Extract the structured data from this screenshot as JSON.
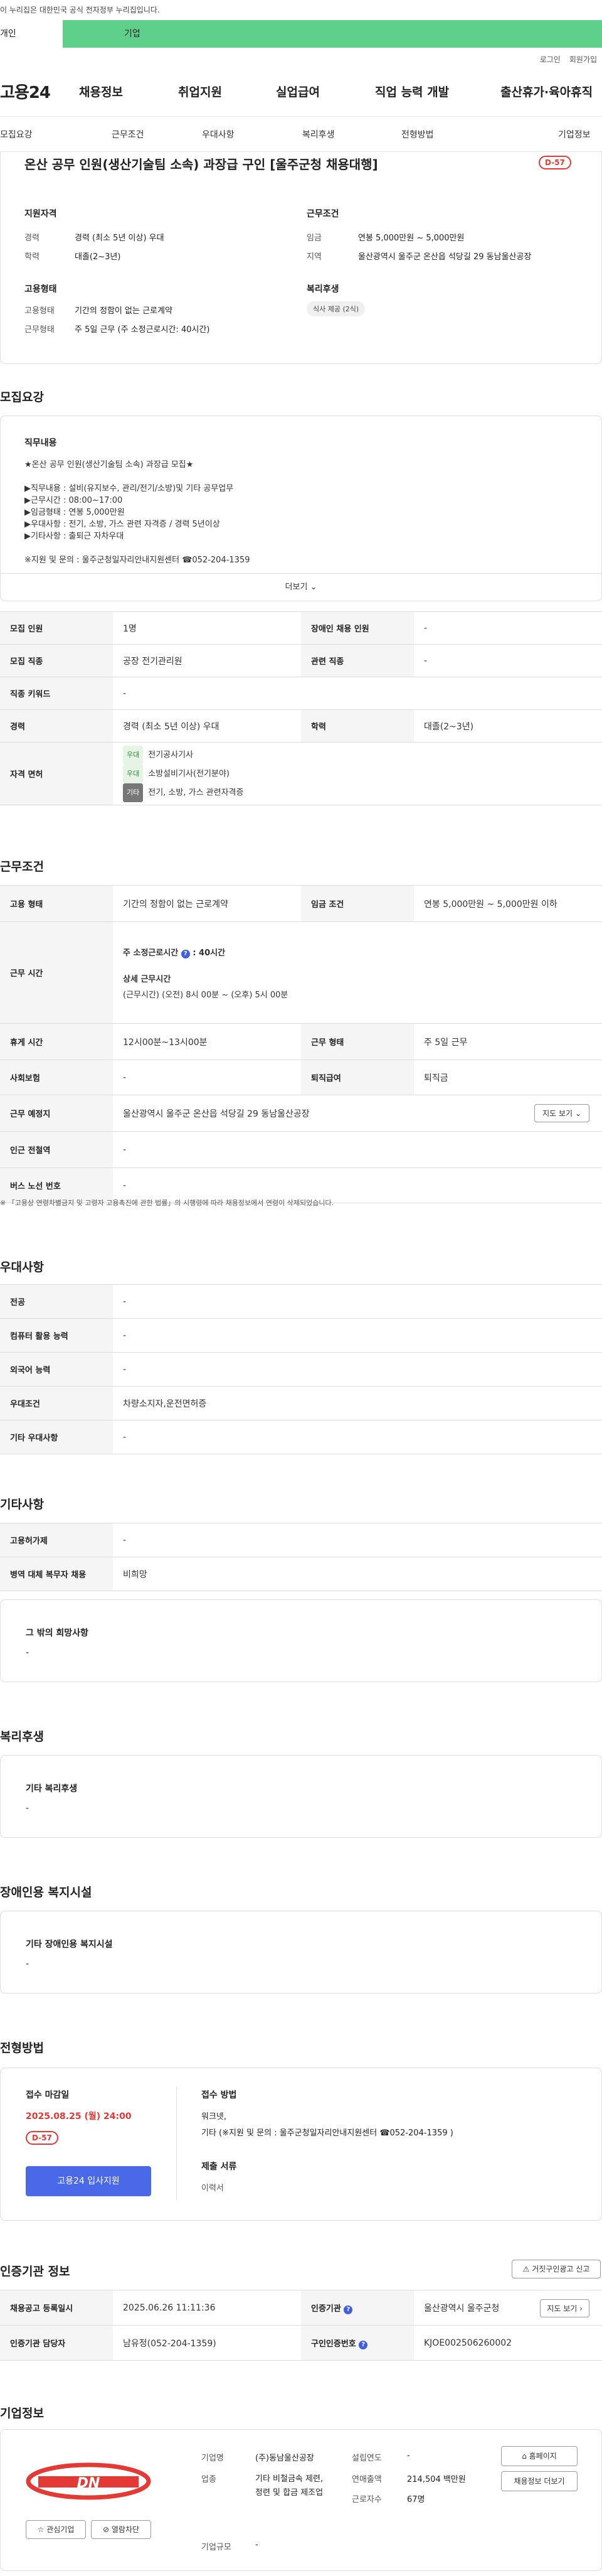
{
  "gov_notice": "이 누리집은 대한민국 공식 전자정부 누리집입니다.",
  "user_tabs": {
    "person": "개인",
    "company": "기업"
  },
  "top_links": {
    "login": "로그인",
    "signup": "회원가입"
  },
  "gnb": {
    "logo": "고용24",
    "items": [
      "채용정보",
      "취업지원",
      "실업급여",
      "직업 능력 개발",
      "출산휴가·육아휴직"
    ]
  },
  "subnav": [
    "모집요강",
    "근무조건",
    "우대사항",
    "복리후생",
    "전형방법",
    "기업정보"
  ],
  "job": {
    "title": "온산 공무 인원(생산기술팀 소속) 과장급 구인 [울주군청 채용대행]",
    "dday": "D-57",
    "qualification_title": "지원자격",
    "career_label": "경력",
    "career_value": "경력 (최소 5년 이상) 우대",
    "education_label": "학력",
    "education_value": "대졸(2~3년)",
    "conditions_title": "근무조건",
    "wage_label": "임금",
    "wage_value": "연봉 5,000만원 ~ 5,000만원",
    "location_label": "지역",
    "location_value": "울산광역시 울주군 온산읍 석당길 29 동남울산공장",
    "employment_title": "고용형태",
    "emp_type_label": "고용형태",
    "emp_type_value": "기간의 정함이 없는 근로계약",
    "work_type_label": "근무형태",
    "work_type_value": "주 5일 근무 (주 소정근로시간: 40시간)",
    "welfare_title": "복리후생",
    "welfare_chip": "식사 제공 (2식)"
  },
  "recruit": {
    "section_title": "모집요강",
    "duty_title": "직무내용",
    "duty_lines": [
      "★온산 공무 인원(생산기술팀 소속) 과장급 모집★",
      "",
      "▶직무내용 : 설비(유지보수, 관리/전기/소방)및 기타 공무업무",
      "▶근무시간 : 08:00~17:00",
      "▶임금형태 : 연봉 5,000만원",
      "▶우대사항 : 전기, 소방, 가스 관련 자격증 / 경력 5년이상",
      "▶기타사항 : 출퇴근 자차우대",
      "",
      "※지원 및 문의 : 울주군청일자리안내지원센터 ☎052-204-1359"
    ],
    "more": "더보기",
    "rows": {
      "count_label": "모집 인원",
      "count_value": "1명",
      "disabled_label": "장애인 채용 인원",
      "disabled_value": "-",
      "job_label": "모집 직종",
      "job_value": "공장 전기관리원",
      "related_label": "관련 직종",
      "related_value": "-",
      "keyword_label": "직종 키워드",
      "keyword_value": "-",
      "career_label": "경력",
      "career_value": "경력 (최소 5년 이상) 우대",
      "edu_label": "학력",
      "edu_value": "대졸(2~3년)",
      "license_label": "자격 면허",
      "licenses": [
        {
          "chip": "우대",
          "name": "전기공사기사"
        },
        {
          "chip": "우대",
          "name": "소방설비기사(전기분야)"
        },
        {
          "chip": "기타",
          "name": "전기, 소방, 가스 관련자격증"
        }
      ]
    }
  },
  "work": {
    "section_title": "근무조건",
    "emp_label": "고용 형태",
    "emp_value": "기간의 정함이 없는 근로계약",
    "wage_label": "임금 조건",
    "wage_value": "연봉 5,000만원 ~ 5,000만원 이하",
    "hours_label": "근무 시간",
    "hours_weekly": "주 소정근로시간",
    "hours_weekly_value": ": 40시간",
    "hours_detail_title": "상세 근무시간",
    "hours_detail": "(근무시간) (오전) 8시 00분 ~ (오후) 5시 00분",
    "break_label": "휴게 시간",
    "break_value": "12시00분~13시00분",
    "form_label": "근무 형태",
    "form_value": "주 5일 근무",
    "insurance_label": "사회보험",
    "insurance_value": "-",
    "severance_label": "퇴직급여",
    "severance_value": "퇴직금",
    "place_label": "근무 예정지",
    "place_value": "울산광역시 울주군 온산읍 석당길 29 동남울산공장",
    "map_btn": "지도 보기",
    "subway_label": "인근 전철역",
    "subway_value": "-",
    "bus_label": "버스 노선 번호",
    "bus_value": "-",
    "notice": "「고용상 연령차별금지 및 고령자 고용촉진에 관한 법률」의 시행령에 따라 채용정보에서 연령이 삭제되었습니다."
  },
  "pref": {
    "section_title": "우대사항",
    "major_label": "전공",
    "major_value": "-",
    "computer_label": "컴퓨터 활용 능력",
    "computer_value": "-",
    "lang_label": "외국어 능력",
    "lang_value": "-",
    "cond_label": "우대조건",
    "cond_value": "차량소지자,운전면허증",
    "etc_label": "기타 우대사항",
    "etc_value": "-"
  },
  "etc": {
    "section_title": "기타사항",
    "insurance_label": "고용허가제",
    "insurance_value": "-",
    "military_label": "병역 대체 복무자 채용",
    "military_value": "비희망",
    "hope_title": "그 밖의 희망사항",
    "hope_value": "-"
  },
  "benefit": {
    "section_title": "복리후생",
    "card_title": "기타 복리후생",
    "card_value": "-"
  },
  "disability": {
    "section_title": "장애인용 복지시설",
    "card_title": "기타 장애인용 복지시설",
    "card_value": "-"
  },
  "selection": {
    "section_title": "전형방법",
    "deadline_label": "접수 마감일",
    "deadline_value": "2025.08.25 (월) 24:00",
    "dday": "D-57",
    "apply_btn": "고용24 입사지원",
    "method_label": "접수 방법",
    "method_line1": "워크넷,",
    "method_line2": "기타 (※지원 및 문의 : 울주군청일자리안내지원센터 ☎052-204-1359 )",
    "docs_label": "제출 서류",
    "docs_value": "이력서"
  },
  "agency": {
    "section_title": "인증기관 정보",
    "report_btn": "거짓구인광고 신고",
    "reg_date_label": "채용공고 등록일시",
    "reg_date_value": "2025.06.26 11:11:36",
    "agency_label": "인증기관",
    "agency_value": "울산광역시 울주군청",
    "map_btn": "지도 보기",
    "manager_label": "인증기관 담당자",
    "manager_value": "남유정(052-204-1359)",
    "cert_label": "구인인증번호",
    "cert_value": "KJOE002506260002"
  },
  "company": {
    "section_title": "기업정보",
    "logo_text": "DN",
    "fav_btn": "관심기업",
    "block_btn": "열람차단",
    "name_label": "기업명",
    "name_value": "(주)동남울산공장",
    "found_label": "설립연도",
    "found_value": "-",
    "industry_label": "업종",
    "industry_value": "기타 비철금속 제련, 정련 및 합금 제조업",
    "sales_label": "연매출액",
    "sales_value": "214,504 백만원",
    "emp_label": "근로자수",
    "emp_value": "67명",
    "scale_label": "기업규모",
    "scale_value": "-",
    "home_btn": "홈페이지",
    "list_btn": "채용정보 더보기"
  },
  "colors": {
    "accent_green": "#5fd08b",
    "dday_red": "#e53935",
    "apply_blue": "#4a69e8"
  }
}
